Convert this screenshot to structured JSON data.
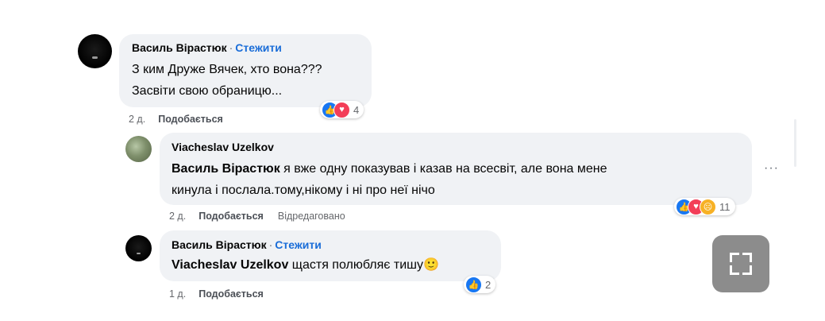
{
  "comments": [
    {
      "author": "Василь Вірастюк",
      "follow": "Стежити",
      "lines": [
        "З ким Друже Вячек, хто вона???",
        "Засвіти свою обраницю..."
      ],
      "time": "2 д.",
      "like_label": "Подобається",
      "reactions": {
        "icons": [
          "like-icon",
          "love-icon"
        ],
        "count": "4"
      }
    },
    {
      "author": "Viacheslav Uzelkov",
      "tag": "Василь Вірастюк",
      "lines": [
        " я вже одну показував і казав на всесвіт, але вона мене",
        "кинула і послала.тому,нікому і ні про неї нічо"
      ],
      "time": "2 д.",
      "like_label": "Подобається",
      "edited": "Відредаговано",
      "reactions": {
        "icons": [
          "like-icon",
          "love-icon",
          "sad-icon"
        ],
        "count": "11"
      }
    },
    {
      "author": "Василь Вірастюк",
      "follow": "Стежити",
      "tag": "Viacheslav Uzelkov",
      "text": " щастя полюбляє тишу",
      "emoji": "🙂",
      "time": "1 д.",
      "like_label": "Подобається",
      "reactions": {
        "icons": [
          "like-icon"
        ],
        "count": "2"
      }
    }
  ],
  "more_options": "···",
  "colors": {
    "follow": "#1a6dd8",
    "bubble": "#f0f2f5",
    "like": "#1877f2",
    "love": "#f33e58",
    "sad": "#f7b125"
  }
}
